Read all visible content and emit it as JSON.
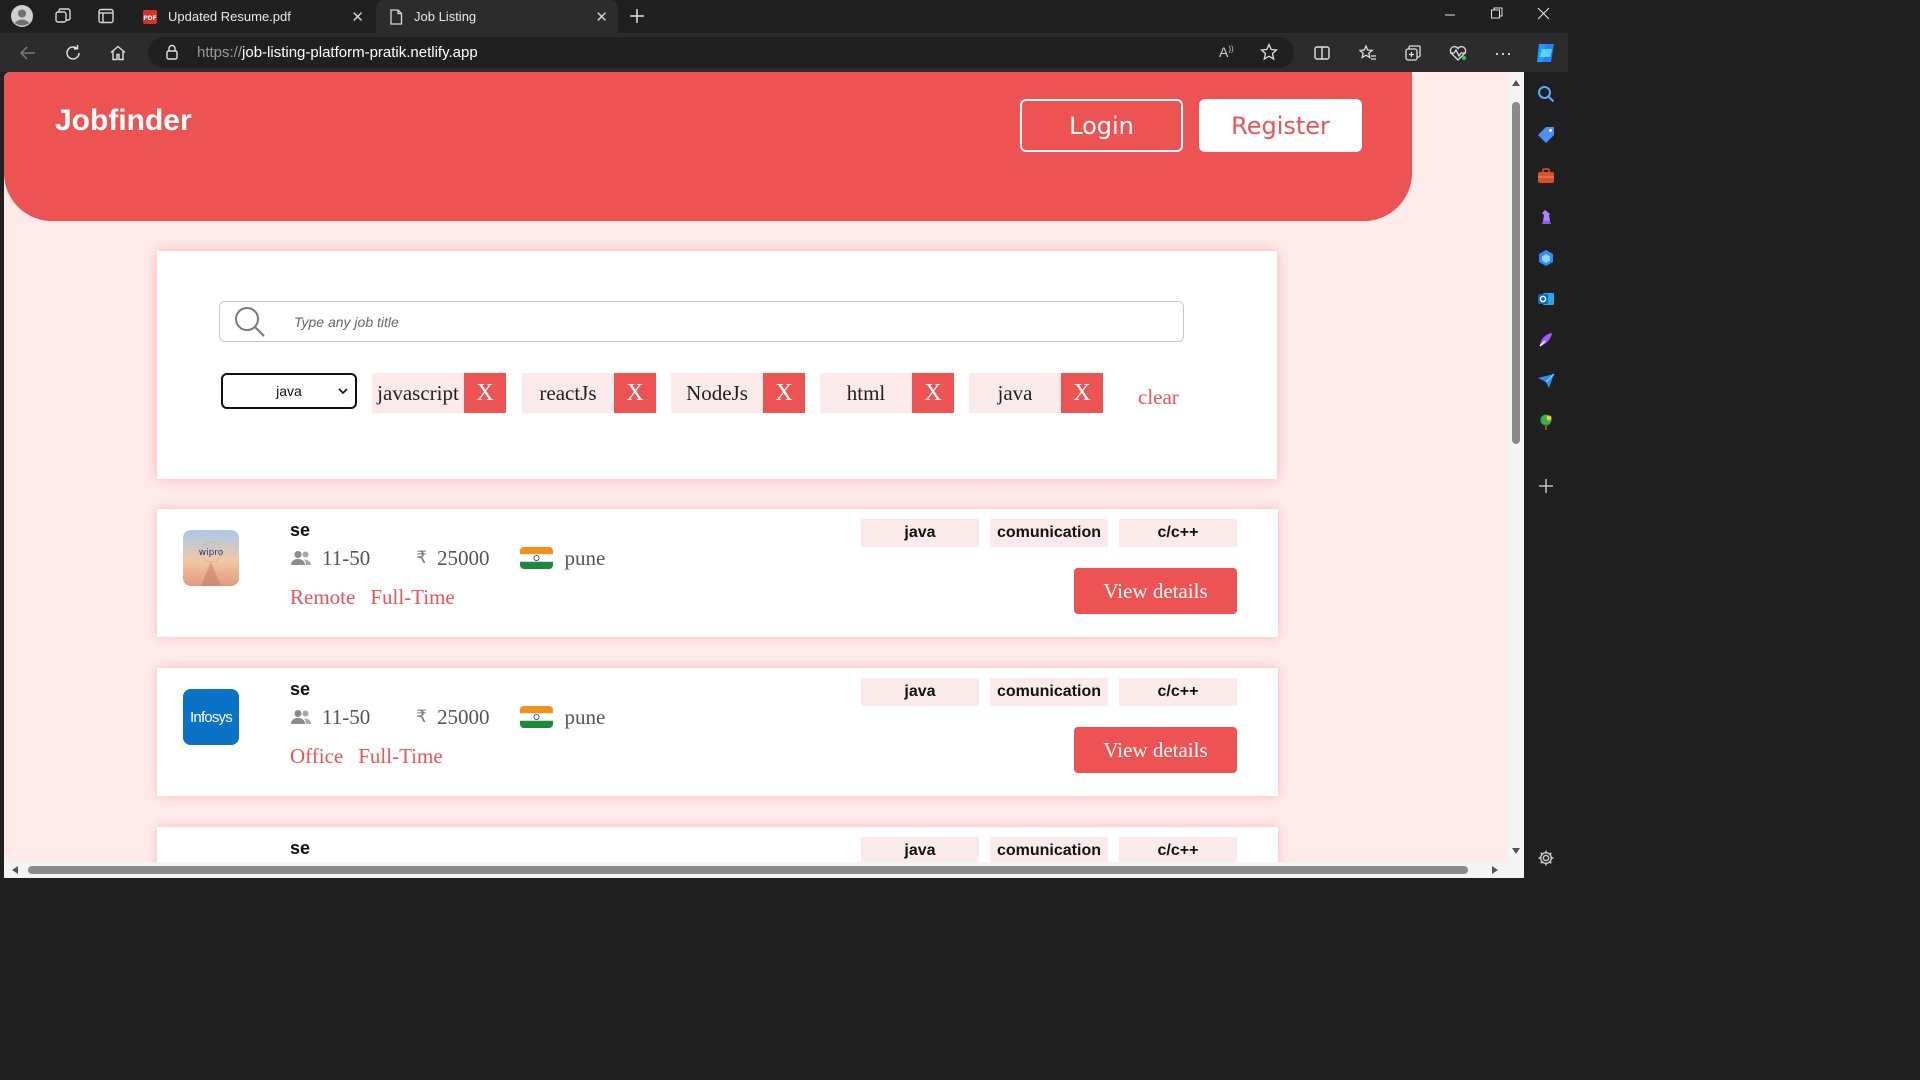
{
  "browser": {
    "tabs": [
      {
        "title": "Updated Resume.pdf",
        "active": false
      },
      {
        "title": "Job Listing",
        "active": true
      }
    ],
    "url_protocol": "https://",
    "url_host": "job-listing-platform-pratik.netlify.app"
  },
  "header": {
    "brand": "Jobfinder",
    "login_label": "Login",
    "register_label": "Register"
  },
  "search": {
    "placeholder": "Type any job title"
  },
  "filters": {
    "select_value": "java",
    "chips": [
      "javascript",
      "reactJs",
      "NodeJs",
      "html",
      "java"
    ],
    "remove_label": "X",
    "clear_label": "clear"
  },
  "jobs": [
    {
      "logo": "wipro",
      "logo_text": "wipro",
      "title": "se",
      "employees": "11-50",
      "currency": "₹",
      "salary": "25000",
      "location": "pune",
      "mode": "Remote",
      "type": "Full-Time",
      "skills": [
        "java",
        "comunication",
        "c/c++"
      ],
      "button_label": "View details"
    },
    {
      "logo": "infosys",
      "logo_text": "Infosys",
      "title": "se",
      "employees": "11-50",
      "currency": "₹",
      "salary": "25000",
      "location": "pune",
      "mode": "Office",
      "type": "Full-Time",
      "skills": [
        "java",
        "comunication",
        "c/c++"
      ],
      "button_label": "View details"
    },
    {
      "title": "se",
      "skills": [
        "java",
        "comunication",
        "c/c++"
      ]
    }
  ],
  "colors": {
    "accent": "#ed5353",
    "page_bg": "#ffeaea",
    "chip_bg": "#fbeaea"
  }
}
